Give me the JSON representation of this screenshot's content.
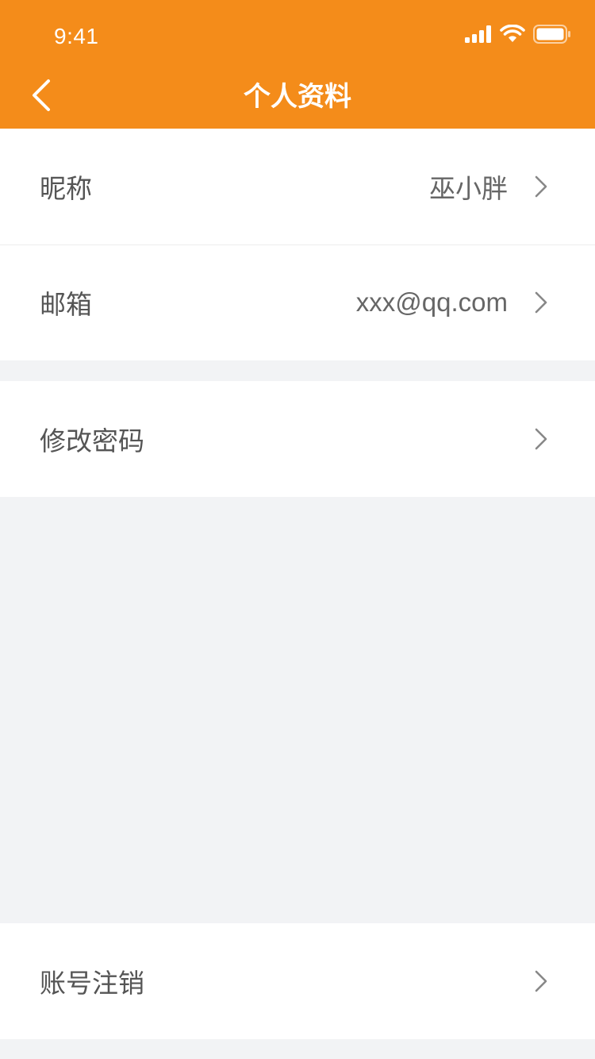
{
  "status_bar": {
    "time": "9:41",
    "icons": [
      "signal-icon",
      "wifi-icon",
      "battery-icon"
    ]
  },
  "nav": {
    "title": "个人资料",
    "back_icon": "chevron-left-icon"
  },
  "profile_group": {
    "rows": [
      {
        "label": "昵称",
        "value": "巫小胖"
      },
      {
        "label": "邮箱",
        "value": "xxx@qq.com"
      }
    ]
  },
  "security_group": {
    "rows": [
      {
        "label": "修改密码",
        "value": ""
      }
    ]
  },
  "account_group": {
    "rows": [
      {
        "label": "账号注销",
        "value": ""
      }
    ]
  },
  "colors": {
    "accent": "#f48c1a",
    "background": "#f2f3f5",
    "row_background": "#ffffff",
    "label_text": "#555555",
    "value_text": "#666666",
    "chevron": "#888888"
  }
}
